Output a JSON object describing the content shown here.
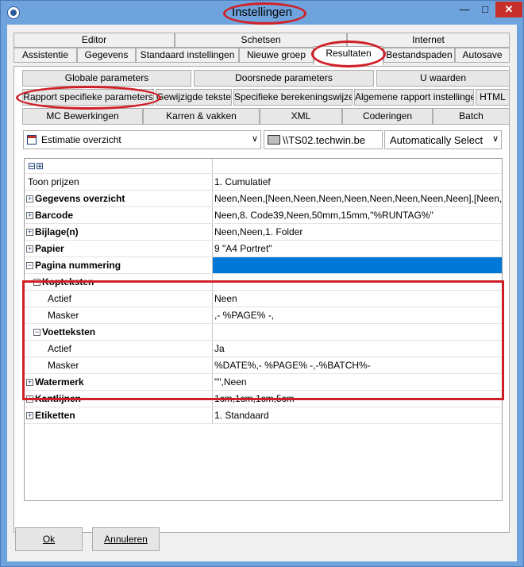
{
  "window": {
    "title": "Instellingen"
  },
  "tabs_row1": [
    "Editor",
    "Schetsen",
    "Internet"
  ],
  "tabs_row2": [
    "Assistentie",
    "Gegevens",
    "Standaard instellingen",
    "Nieuwe groep",
    "Resultaten",
    "Bestandspaden",
    "Autosave"
  ],
  "active_tab": "Resultaten",
  "subtabs_row1": [
    "Globale parameters",
    "Doorsnede parameters",
    "U waarden"
  ],
  "subtabs_row2": [
    "Rapport specifieke parameters",
    "Gewijzigde teksten",
    "Specifieke berekeningswijzen",
    "Algemene rapport instellingen",
    "HTML"
  ],
  "subtabs_row3": [
    "MC Bewerkingen",
    "Karren & vakken",
    "XML",
    "Coderingen",
    "Batch"
  ],
  "selectors": {
    "report": "Estimatie overzicht",
    "printer": "\\\\TS02.techwin.be",
    "mode": "Automatically Select"
  },
  "grid": {
    "header_expand": "⊟⊞",
    "rows": [
      {
        "label": "Toon prijzen",
        "value": "1. Cumulatief",
        "bold": false,
        "expander": "",
        "indent": 0
      },
      {
        "label": "Gegevens overzicht",
        "value": "Neen,Neen,[Neen,Neen,Neen,Neen,Neen,Neen,Neen,Neen],[Neen,Neen,N",
        "bold": true,
        "expander": "+",
        "indent": 0
      },
      {
        "label": "Barcode",
        "value": "Neen,8. Code39,Neen,50mm,15mm,\"%RUNTAG%\"",
        "bold": true,
        "expander": "+",
        "indent": 0
      },
      {
        "label": "Bijlage(n)",
        "value": "Neen,Neen,1. Folder",
        "bold": true,
        "expander": "+",
        "indent": 0
      },
      {
        "label": "Papier",
        "value": "9 \"A4 Portret\"",
        "bold": true,
        "expander": "+",
        "indent": 0
      },
      {
        "label": "Pagina nummering",
        "value": "",
        "bold": true,
        "expander": "−",
        "indent": 0,
        "selected": true
      },
      {
        "label": "Kopteksten",
        "value": "",
        "bold": true,
        "expander": "−",
        "indent": 1
      },
      {
        "label": "Actief",
        "value": "Neen",
        "bold": false,
        "expander": "",
        "indent": 2
      },
      {
        "label": "Masker",
        "value": ",- %PAGE% -,",
        "bold": false,
        "expander": "",
        "indent": 2
      },
      {
        "label": "Voetteksten",
        "value": "",
        "bold": true,
        "expander": "−",
        "indent": 1
      },
      {
        "label": "Actief",
        "value": "Ja",
        "bold": false,
        "expander": "",
        "indent": 2
      },
      {
        "label": "Masker",
        "value": "%DATE%,- %PAGE% -,-%BATCH%-",
        "bold": false,
        "expander": "",
        "indent": 2
      },
      {
        "label": "Watermerk",
        "value": "\"\",Neen",
        "bold": true,
        "expander": "+",
        "indent": 0
      },
      {
        "label": "Kantlijnen",
        "value": "1cm,1cm,1cm,5cm",
        "bold": true,
        "expander": "+",
        "indent": 0
      },
      {
        "label": "Etiketten",
        "value": "1. Standaard",
        "bold": true,
        "expander": "+",
        "indent": 0
      }
    ]
  },
  "buttons": {
    "ok": "Ok",
    "cancel": "Annuleren"
  },
  "colors": {
    "selection": "#0078d7",
    "highlight": "#d02027"
  }
}
